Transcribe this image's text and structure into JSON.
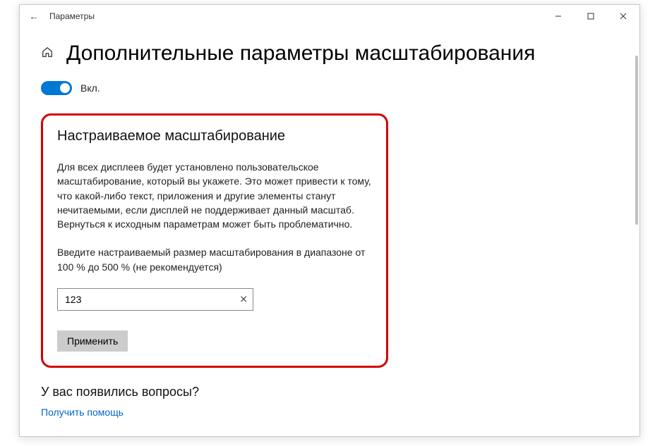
{
  "titlebar": {
    "title": "Параметры"
  },
  "page": {
    "heading": "Дополнительные параметры масштабирования",
    "toggle_label": "Вкл."
  },
  "custom_scaling": {
    "section_title": "Настраиваемое масштабирование",
    "description": "Для всех дисплеев будет установлено пользовательское масштабирование, который вы укажете. Это может привести к тому, что какой-либо текст, приложения и другие элементы станут нечитаемыми, если дисплей не поддерживает данный масштаб. Вернуться к исходным параметрам может быть проблематично.",
    "input_hint": "Введите настраиваемый размер масштабирования в диапазоне от 100 % до 500 % (не рекомендуется)",
    "input_value": "123",
    "apply_label": "Применить"
  },
  "help": {
    "question_title": "У вас появились вопросы?",
    "link_label": "Получить помощь"
  }
}
